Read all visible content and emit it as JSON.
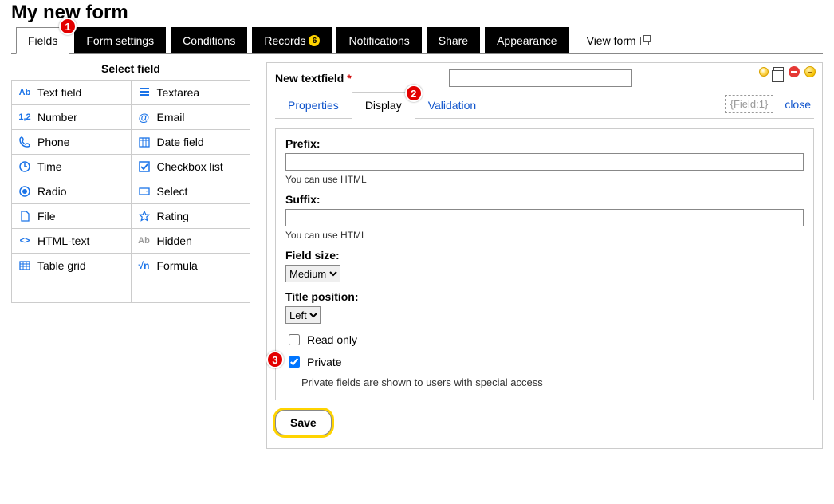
{
  "title": "My new form",
  "tabs": [
    {
      "label": "Fields",
      "active": true,
      "badge": null
    },
    {
      "label": "Form settings",
      "active": false,
      "badge": null
    },
    {
      "label": "Conditions",
      "active": false,
      "badge": null
    },
    {
      "label": "Records",
      "active": false,
      "badge": "6"
    },
    {
      "label": "Notifications",
      "active": false,
      "badge": null
    },
    {
      "label": "Share",
      "active": false,
      "badge": null
    },
    {
      "label": "Appearance",
      "active": false,
      "badge": null
    }
  ],
  "view_form": "View form",
  "select_field_title": "Select field",
  "field_types": [
    {
      "icon": "Ab",
      "label": "Text field"
    },
    {
      "icon": "lines",
      "label": "Textarea"
    },
    {
      "icon": "1,2",
      "label": "Number"
    },
    {
      "icon": "@",
      "label": "Email"
    },
    {
      "icon": "phone",
      "label": "Phone"
    },
    {
      "icon": "grid",
      "label": "Date field"
    },
    {
      "icon": "clock",
      "label": "Time"
    },
    {
      "icon": "check",
      "label": "Checkbox list"
    },
    {
      "icon": "radio",
      "label": "Radio"
    },
    {
      "icon": "select",
      "label": "Select"
    },
    {
      "icon": "file",
      "label": "File"
    },
    {
      "icon": "star",
      "label": "Rating"
    },
    {
      "icon": "<>",
      "label": "HTML-text"
    },
    {
      "icon": "Ab",
      "label": "Hidden",
      "muted": true
    },
    {
      "icon": "grid",
      "label": "Table grid"
    },
    {
      "icon": "√n",
      "label": "Formula"
    }
  ],
  "panel": {
    "field_label": "New textfield",
    "required_mark": "*",
    "field_value": "",
    "subtabs": [
      "Properties",
      "Display",
      "Validation"
    ],
    "active_subtab": "Display",
    "field_token": "{Field:1}",
    "close": "close",
    "prefix_label": "Prefix:",
    "prefix_value": "",
    "prefix_hint": "You can use HTML",
    "suffix_label": "Suffix:",
    "suffix_value": "",
    "suffix_hint": "You can use HTML",
    "fieldsize_label": "Field size:",
    "fieldsize_value": "Medium",
    "titlepos_label": "Title position:",
    "titlepos_value": "Left",
    "readonly_label": "Read only",
    "readonly_checked": false,
    "private_label": "Private",
    "private_checked": true,
    "private_hint": "Private fields are shown to users with special access",
    "save": "Save"
  },
  "callouts": {
    "1": "1",
    "2": "2",
    "3": "3"
  }
}
